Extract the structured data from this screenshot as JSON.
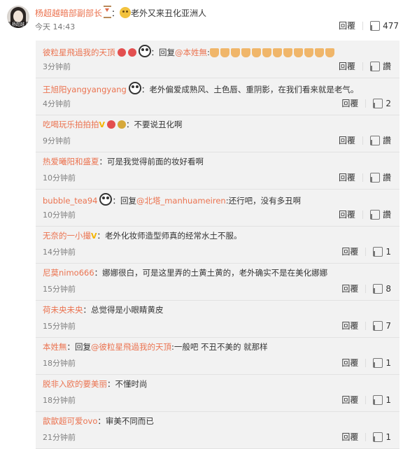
{
  "top_comment": {
    "username": "杨超越暗部副部长",
    "text": "老外又来丑化亚洲人",
    "time": "今天 14:43",
    "reply_label": "回覆",
    "likes": "477",
    "avatar_tag": "杨超越"
  },
  "replies": [
    {
      "username": "彼粒星飛過我的天頂",
      "icons": [
        "badge",
        "badge",
        "panda"
      ],
      "prefix": "：回复",
      "mention": "@本姓無",
      "after": ":",
      "emoji_count": 12,
      "text": "",
      "time": "3分钟前",
      "reply_label": "回覆",
      "like_label": "讚"
    },
    {
      "username": "王旭阳yangyangyang",
      "icons": [
        "panda"
      ],
      "prefix": "：",
      "mention": "",
      "after": "",
      "text": "老外偏爱成熟风、土色唇、重阴影，在我们看来就是老气。",
      "time": "4分钟前",
      "reply_label": "回覆",
      "like_label": "2"
    },
    {
      "username": "吃喝玩乐拍拍拍",
      "icons": [
        "v",
        "badge",
        "badge3"
      ],
      "prefix": "：",
      "mention": "",
      "after": "",
      "text": "不要说丑化啊",
      "time": "9分钟前",
      "reply_label": "回覆",
      "like_label": "讚"
    },
    {
      "username": "热爱曦阳和盛夏",
      "icons": [],
      "prefix": "：",
      "mention": "",
      "after": "",
      "text": "可是我觉得前面的妆好看啊",
      "time": "10分钟前",
      "reply_label": "回覆",
      "like_label": "讚"
    },
    {
      "username": "bubble_tea94",
      "icons": [
        "panda"
      ],
      "prefix": "：回复",
      "mention": "@北塔_manhuameiren",
      "after": ":",
      "text": "还行吧，没有多丑啊",
      "time": "10分钟前",
      "reply_label": "回覆",
      "like_label": "讚"
    },
    {
      "username": "无奈的一小撮",
      "icons": [
        "v"
      ],
      "prefix": "：",
      "mention": "",
      "after": "",
      "text": "老外化妆师造型师真的经常水土不服。",
      "time": "14分钟前",
      "reply_label": "回覆",
      "like_label": "1"
    },
    {
      "username": "尼莫nimo666",
      "icons": [],
      "prefix": "：",
      "mention": "",
      "after": "",
      "text": "娜娜很白，可是这里弄的土黄土黄的，老外确实不是在美化娜娜",
      "time": "15分钟前",
      "reply_label": "回覆",
      "like_label": "8"
    },
    {
      "username": "荷未央未央",
      "icons": [],
      "prefix": "：",
      "mention": "",
      "after": "",
      "text": "总觉得是小眼睛黄皮",
      "time": "15分钟前",
      "reply_label": "回覆",
      "like_label": "7"
    },
    {
      "username": "本姓無",
      "icons": [],
      "prefix": "：回复",
      "mention": "@彼粒星飛過我的天頂",
      "after": ":",
      "text": "一般吧 不丑不美的 就那样",
      "time": "18分钟前",
      "reply_label": "回覆",
      "like_label": "1"
    },
    {
      "username": "脱非入欧的要美丽",
      "icons": [],
      "prefix": "：",
      "mention": "",
      "after": "",
      "text": "不懂时尚",
      "time": "18分钟前",
      "reply_label": "回覆",
      "like_label": "1"
    },
    {
      "username": "歆歆超可爱ovo",
      "icons": [],
      "prefix": "：",
      "mention": "",
      "after": "",
      "text": "审美不同而已",
      "time": "21分钟前",
      "reply_label": "回覆",
      "like_label": "1"
    }
  ]
}
